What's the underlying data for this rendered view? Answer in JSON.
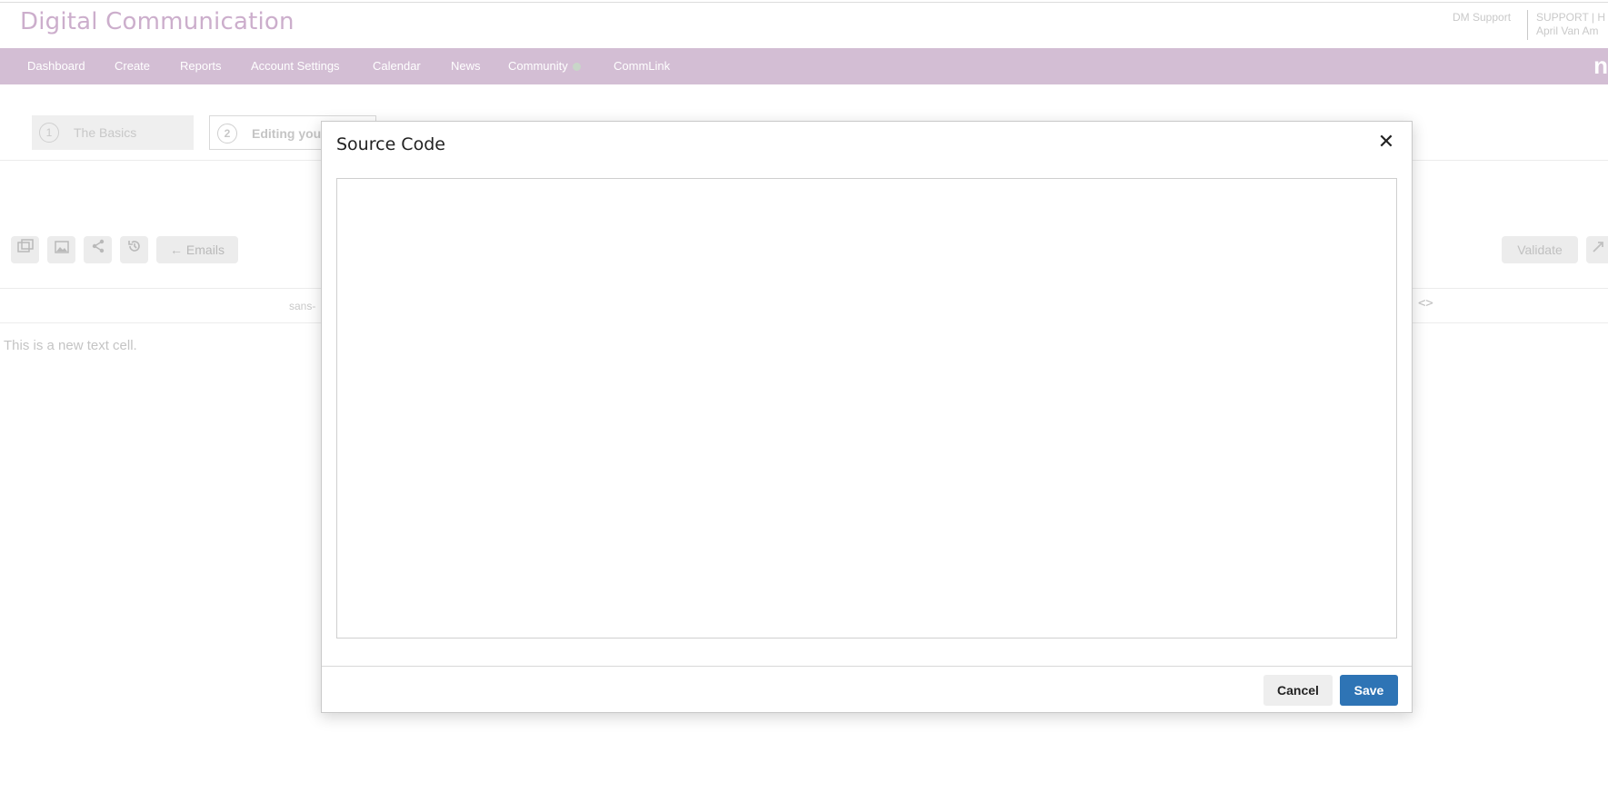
{
  "header": {
    "app_title": "Digital Communication",
    "support_link": "DM Support",
    "user_top": "SUPPORT | H",
    "user_bottom": "April Van Am"
  },
  "nav": {
    "items": [
      {
        "label": "Dashboard"
      },
      {
        "label": "Create"
      },
      {
        "label": "Reports"
      },
      {
        "label": "Account Settings"
      },
      {
        "label": "Calendar"
      },
      {
        "label": "News"
      },
      {
        "label": "Community"
      },
      {
        "label": "CommLink"
      }
    ],
    "logo_glyph": "n",
    "community_dot_color": "#c8d6c8"
  },
  "steps": [
    {
      "number": "1",
      "label": "The Basics"
    },
    {
      "number": "2",
      "label": "Editing you"
    }
  ],
  "toolbar": {
    "emails_label": "← Emails",
    "validate_label": "Validate"
  },
  "editor": {
    "font_label": "sans-",
    "code_toggle": "<>",
    "cell_text": "This is a new text cell."
  },
  "modal": {
    "title": "Source Code",
    "close_glyph": "✕",
    "code_value": "",
    "cancel_label": "Cancel",
    "save_label": "Save",
    "save_color": "#2e74b5"
  }
}
